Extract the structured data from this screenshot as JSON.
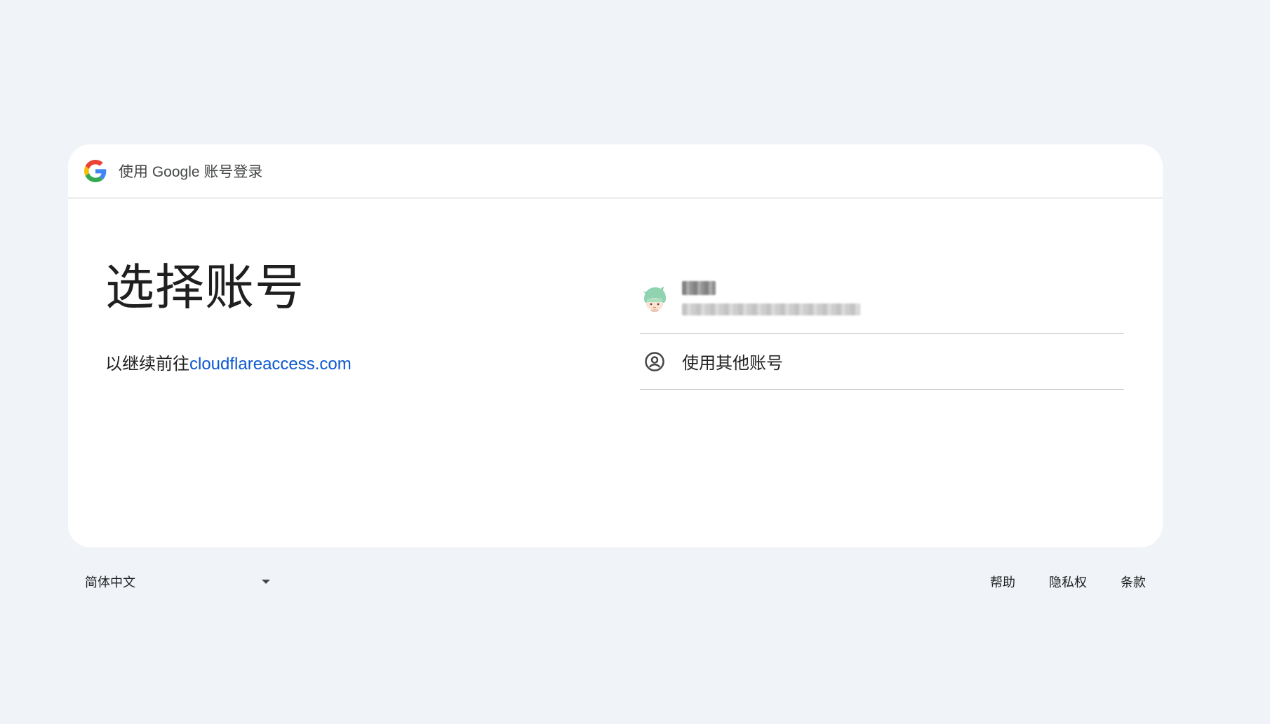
{
  "header": {
    "logo_icon": "google-g-icon",
    "text": "使用 Google 账号登录"
  },
  "main": {
    "title": "选择账号",
    "subtitle_prefix": "以继续前往",
    "subtitle_link": "cloudflareaccess.com"
  },
  "accounts": {
    "items": [
      {
        "avatar_icon": "user-avatar"
      }
    ],
    "other_account": {
      "icon": "account-circle-icon",
      "label": "使用其他账号"
    }
  },
  "footer": {
    "language": "简体中文",
    "links": [
      "帮助",
      "隐私权",
      "条款"
    ]
  },
  "colors": {
    "background": "#f0f4f9",
    "card": "#ffffff",
    "link": "#0b57d0",
    "divider": "#c4c7c5"
  }
}
